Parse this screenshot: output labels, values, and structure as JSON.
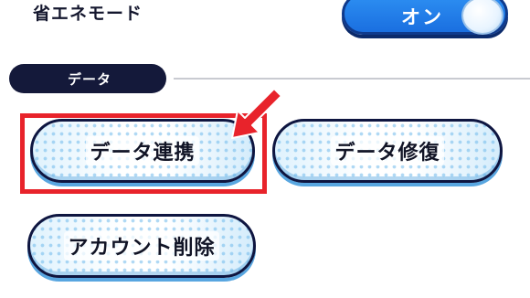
{
  "settings": {
    "power_saving": {
      "label": "省エネモード",
      "toggle_text": "オン",
      "enabled": true
    }
  },
  "section": {
    "title": "データ"
  },
  "buttons": {
    "data_link": "データ連携",
    "data_repair": "データ修復",
    "account_delete": "アカウント削除"
  },
  "colors": {
    "toggle_blue": "#1a6fe0",
    "section_pill": "#14193a",
    "highlight_red": "#e8232b",
    "button_border": "#0e1540",
    "button_accent": "#58a6e0"
  },
  "annotations": {
    "highlighted_button": "data_link",
    "arrow_icon": "red-arrow-icon"
  }
}
